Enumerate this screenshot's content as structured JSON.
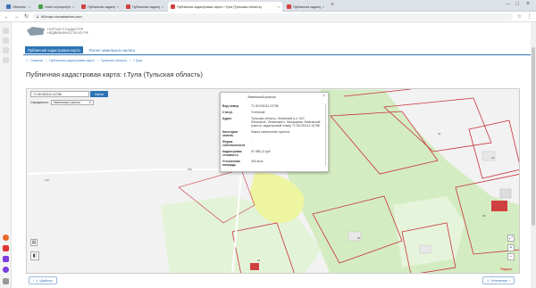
{
  "browser": {
    "tabs": [
      {
        "title": "Объекты недвижимости - E",
        "color": "#3d6fb6"
      },
      {
        "title": "cmkb.ru/property/ebus/...",
        "color": "#4aa04a"
      },
      {
        "title": "Публичная кадастровая...",
        "color": "#d04040"
      },
      {
        "title": "Публичная кадастровая...",
        "color": "#d04040"
      },
      {
        "title": "Публичная кадастровая карта: г.Тула (Тульская область)",
        "color": "#d04040"
      },
      {
        "title": "Публичная кадастровая...",
        "color": "#d04040"
      }
    ],
    "url": "ik2map.roscadastres.com"
  },
  "header": {
    "logo_text_line1": "ПОРТАЛ О КАДАСТРЕ",
    "logo_text_line2": "НЕДВИЖИМОСТИ ИЗ РФ"
  },
  "nav": {
    "tab_active": "Публичная кадастровая карта",
    "tab_other": "Расчет земельного налога"
  },
  "breadcrumb": [
    "Главная",
    "Публичная кадастровая карта",
    "Тульская область",
    "г.Тула"
  ],
  "page_title": "Публичная кадастровая карта: г.Тула (Тульская область)",
  "map": {
    "search_value": "71:30:030111:10768",
    "search_button": "Найти",
    "define_label": "Определить:",
    "define_value": "Земельные участки",
    "labels": [
      "562",
      "116",
      "34",
      "89",
      "90",
      "34",
      "91"
    ],
    "yandex": "Яндекс"
  },
  "popup": {
    "heading": "Земельный участок",
    "rows": [
      {
        "k": "Вид номер",
        "v": "71:30:030111:10768"
      },
      {
        "k": "Статус",
        "v": "Учтенный"
      },
      {
        "k": "Адрес",
        "v": "Тульская область, Ленинский р-н, МО Ленинское, Ленинский п. Мальцевка: Земельный участок, кадастровый номер 71:30:030111:10768"
      },
      {
        "k": "Категория земель",
        "v": "Земли населенных пунктов"
      },
      {
        "k": "Форма собственности",
        "v": "-"
      },
      {
        "k": "Кадастровая стоимость",
        "v": "91 988,12 руб"
      },
      {
        "k": "Уточненная площадь",
        "v": "300 кв.м"
      }
    ]
  },
  "pager": {
    "prev": "1. Шаблон",
    "next": "1. Уточнения"
  }
}
